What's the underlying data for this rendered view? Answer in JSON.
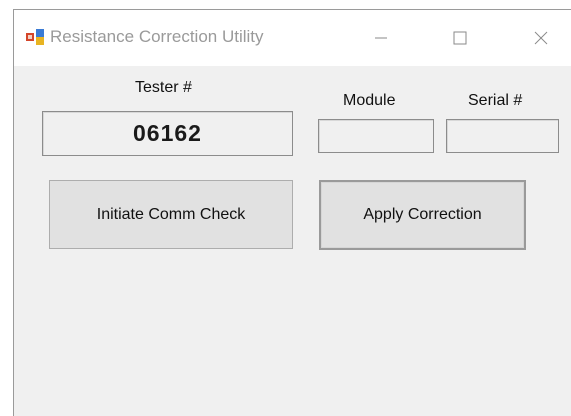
{
  "window": {
    "title": "Resistance Correction Utility",
    "controls": {
      "minimize_icon": "minimize-icon",
      "maximize_icon": "maximize-icon",
      "close_icon": "close-icon"
    }
  },
  "form": {
    "tester_label": "Tester #",
    "tester_value": "06162",
    "module_label": "Module",
    "module_value": "",
    "serial_label": "Serial #",
    "serial_value": ""
  },
  "buttons": {
    "initiate_label": "Initiate Comm Check",
    "apply_label": "Apply Correction"
  },
  "colors": {
    "window_background": "#f0f0f0",
    "titlebar_background": "#ffffff",
    "button_face": "#e1e1e1",
    "title_text": "#9a9a9a"
  }
}
